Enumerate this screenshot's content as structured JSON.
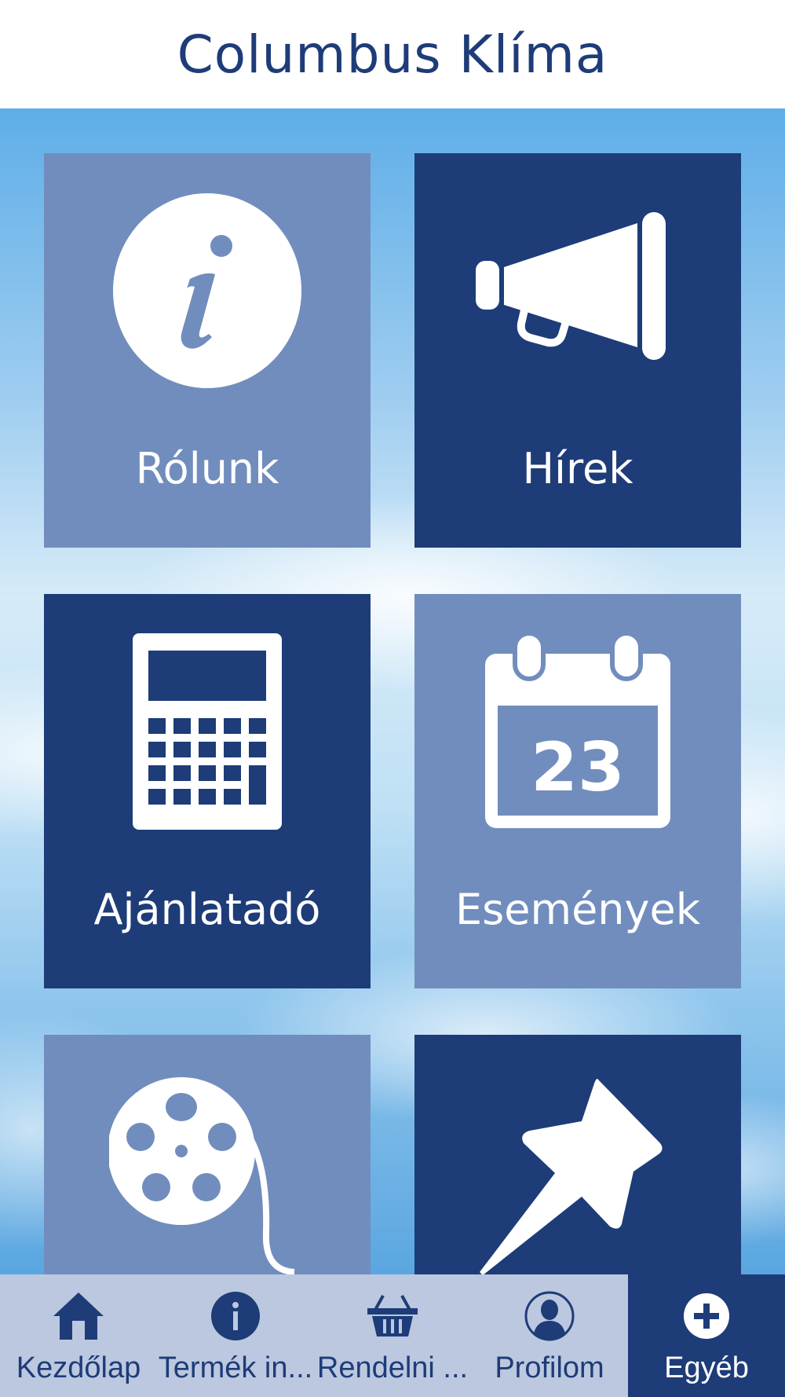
{
  "header": {
    "title": "Columbus Klíma"
  },
  "tiles": [
    {
      "label": "Rólunk",
      "icon": "info-icon"
    },
    {
      "label": "Hírek",
      "icon": "megaphone-icon"
    },
    {
      "label": "Ajánlatadó",
      "icon": "calculator-icon"
    },
    {
      "label": "Események",
      "icon": "calendar-icon",
      "day": "23"
    },
    {
      "label": "",
      "icon": "film-reel-icon"
    },
    {
      "label": "",
      "icon": "pushpin-icon"
    }
  ],
  "tabbar": {
    "items": [
      {
        "label": "Kezdőlap",
        "icon": "home-icon"
      },
      {
        "label": "Termék in...",
        "icon": "info-circle-icon"
      },
      {
        "label": "Rendelni ...",
        "icon": "basket-icon"
      },
      {
        "label": "Profilom",
        "icon": "profile-icon"
      },
      {
        "label": "Egyéb",
        "icon": "plus-icon",
        "active": true
      }
    ]
  },
  "colors": {
    "primary": "#1d3c78",
    "tile_light": "#718dbd",
    "tabbar_bg": "#bcc8df"
  }
}
